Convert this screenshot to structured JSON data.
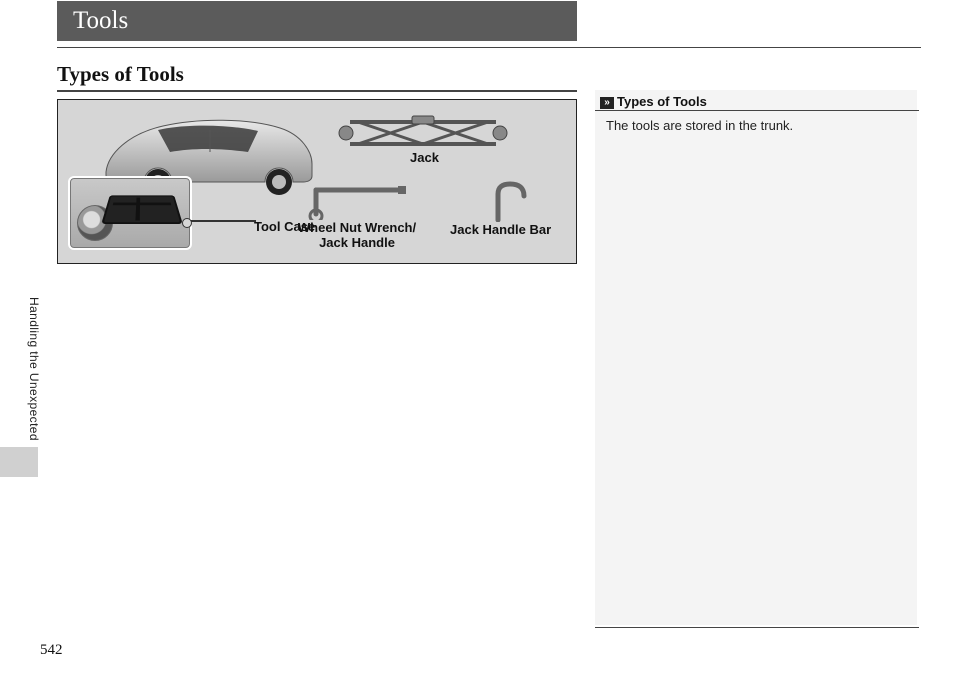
{
  "chapter_title": "Tools",
  "section_heading": "Types of Tools",
  "figure": {
    "labels": {
      "tool_case": "Tool Case",
      "jack": "Jack",
      "wrench": "Wheel Nut Wrench/\nJack Handle",
      "jack_handle_bar": "Jack Handle Bar"
    }
  },
  "side": {
    "heading": "Types of Tools",
    "body": "The tools are stored in the trunk."
  },
  "margin_tab": "Handling the Unexpected",
  "page_number": "542"
}
